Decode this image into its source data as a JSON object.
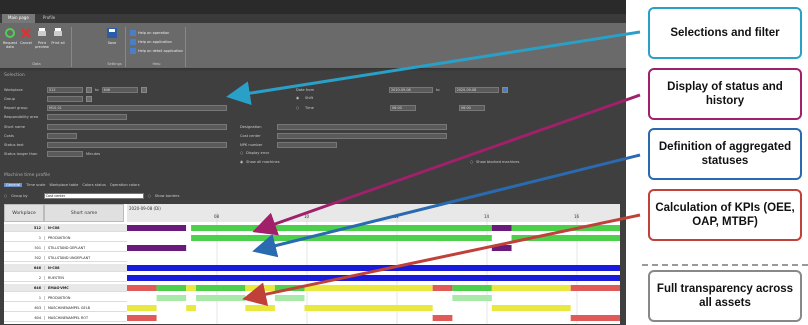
{
  "app": {
    "tabs": [
      "Main page",
      "Profile"
    ],
    "ribbon": {
      "data_group": {
        "label": "Data",
        "buttons": [
          "Request data",
          "Cancel",
          "Print preview",
          "Print all"
        ]
      },
      "settings_group": {
        "label": "Settings",
        "buttons": [
          "Save"
        ]
      },
      "help_group": {
        "label": "Help",
        "items": [
          "Help on operation",
          "Help on application",
          "Help on detail application"
        ]
      }
    },
    "selection": {
      "title": "Selection",
      "workplace_label": "Workplace",
      "workplace_from": "512",
      "to_label": "to",
      "workplace_to": "646",
      "group_label": "Group",
      "report_group_label": "Report group",
      "report_group_value": "M10-01",
      "responsibility_label": "Responsibility area",
      "short_name_label": "Short name",
      "costs_label": "Costs",
      "status_text_label": "Status text",
      "status_longer_label": "Status longer than",
      "minutes": "Minutes",
      "date_from_label": "Date from",
      "date_from": "2020-09-08",
      "date_to": "2020-09-08",
      "shift_label": "Shift",
      "time_label": "Time",
      "time_from": "06:00",
      "time_to": "06:00",
      "designation_label": "Designation",
      "cost_center_label": "Cost center",
      "npk_label": "NPK number",
      "display_error": "Display error",
      "show_all": "Show all machines",
      "show_blocked": "Show blocked machines"
    },
    "profile": {
      "title": "Machine time profile",
      "subtabs": [
        "General",
        "Time scale",
        "Workplace table",
        "Colors status",
        "Operation colors"
      ],
      "group_by_label": "Group by",
      "group_by_value": "Cost center",
      "show_borders": "Show borders",
      "col_workplace": "Workplace",
      "col_short_name": "Short name",
      "date_header": "2020-09-08 (Di)",
      "hours": [
        "08",
        "10",
        "12",
        "14",
        "16"
      ],
      "rows": [
        {
          "wp": "512",
          "name": "N-C08",
          "hdr": true
        },
        {
          "wp": "1",
          "name": "PRODUKTION"
        },
        {
          "wp": "501",
          "name": "STILLSTAND GEPLANT"
        },
        {
          "wp": "502",
          "name": "STILLSTAND UNGEPLANT"
        },
        {
          "wp": "646",
          "name": "N-C08",
          "hdr": true
        },
        {
          "wp": "2",
          "name": "RUESTEN"
        },
        {
          "wp": "646",
          "name": "EMAG-VMC",
          "hdr": true
        },
        {
          "wp": "1",
          "name": "PRODUKTION"
        },
        {
          "wp": "603",
          "name": "MASCHINENAMPEL GELB"
        },
        {
          "wp": "604",
          "name": "MASCHINENAMPEL ROT"
        }
      ]
    }
  },
  "callouts": [
    {
      "text": "Selections and filter",
      "color": "#2aa0c8"
    },
    {
      "text": "Display of status and history",
      "color": "#a0206a"
    },
    {
      "text": "Definition of aggregated statuses",
      "color": "#2a6ab0"
    },
    {
      "text": "Calculation of KPIs (OEE, OAP, MTBF)",
      "color": "#c0403a"
    },
    {
      "text": "Full transparency across all assets",
      "color": "#888888"
    }
  ]
}
